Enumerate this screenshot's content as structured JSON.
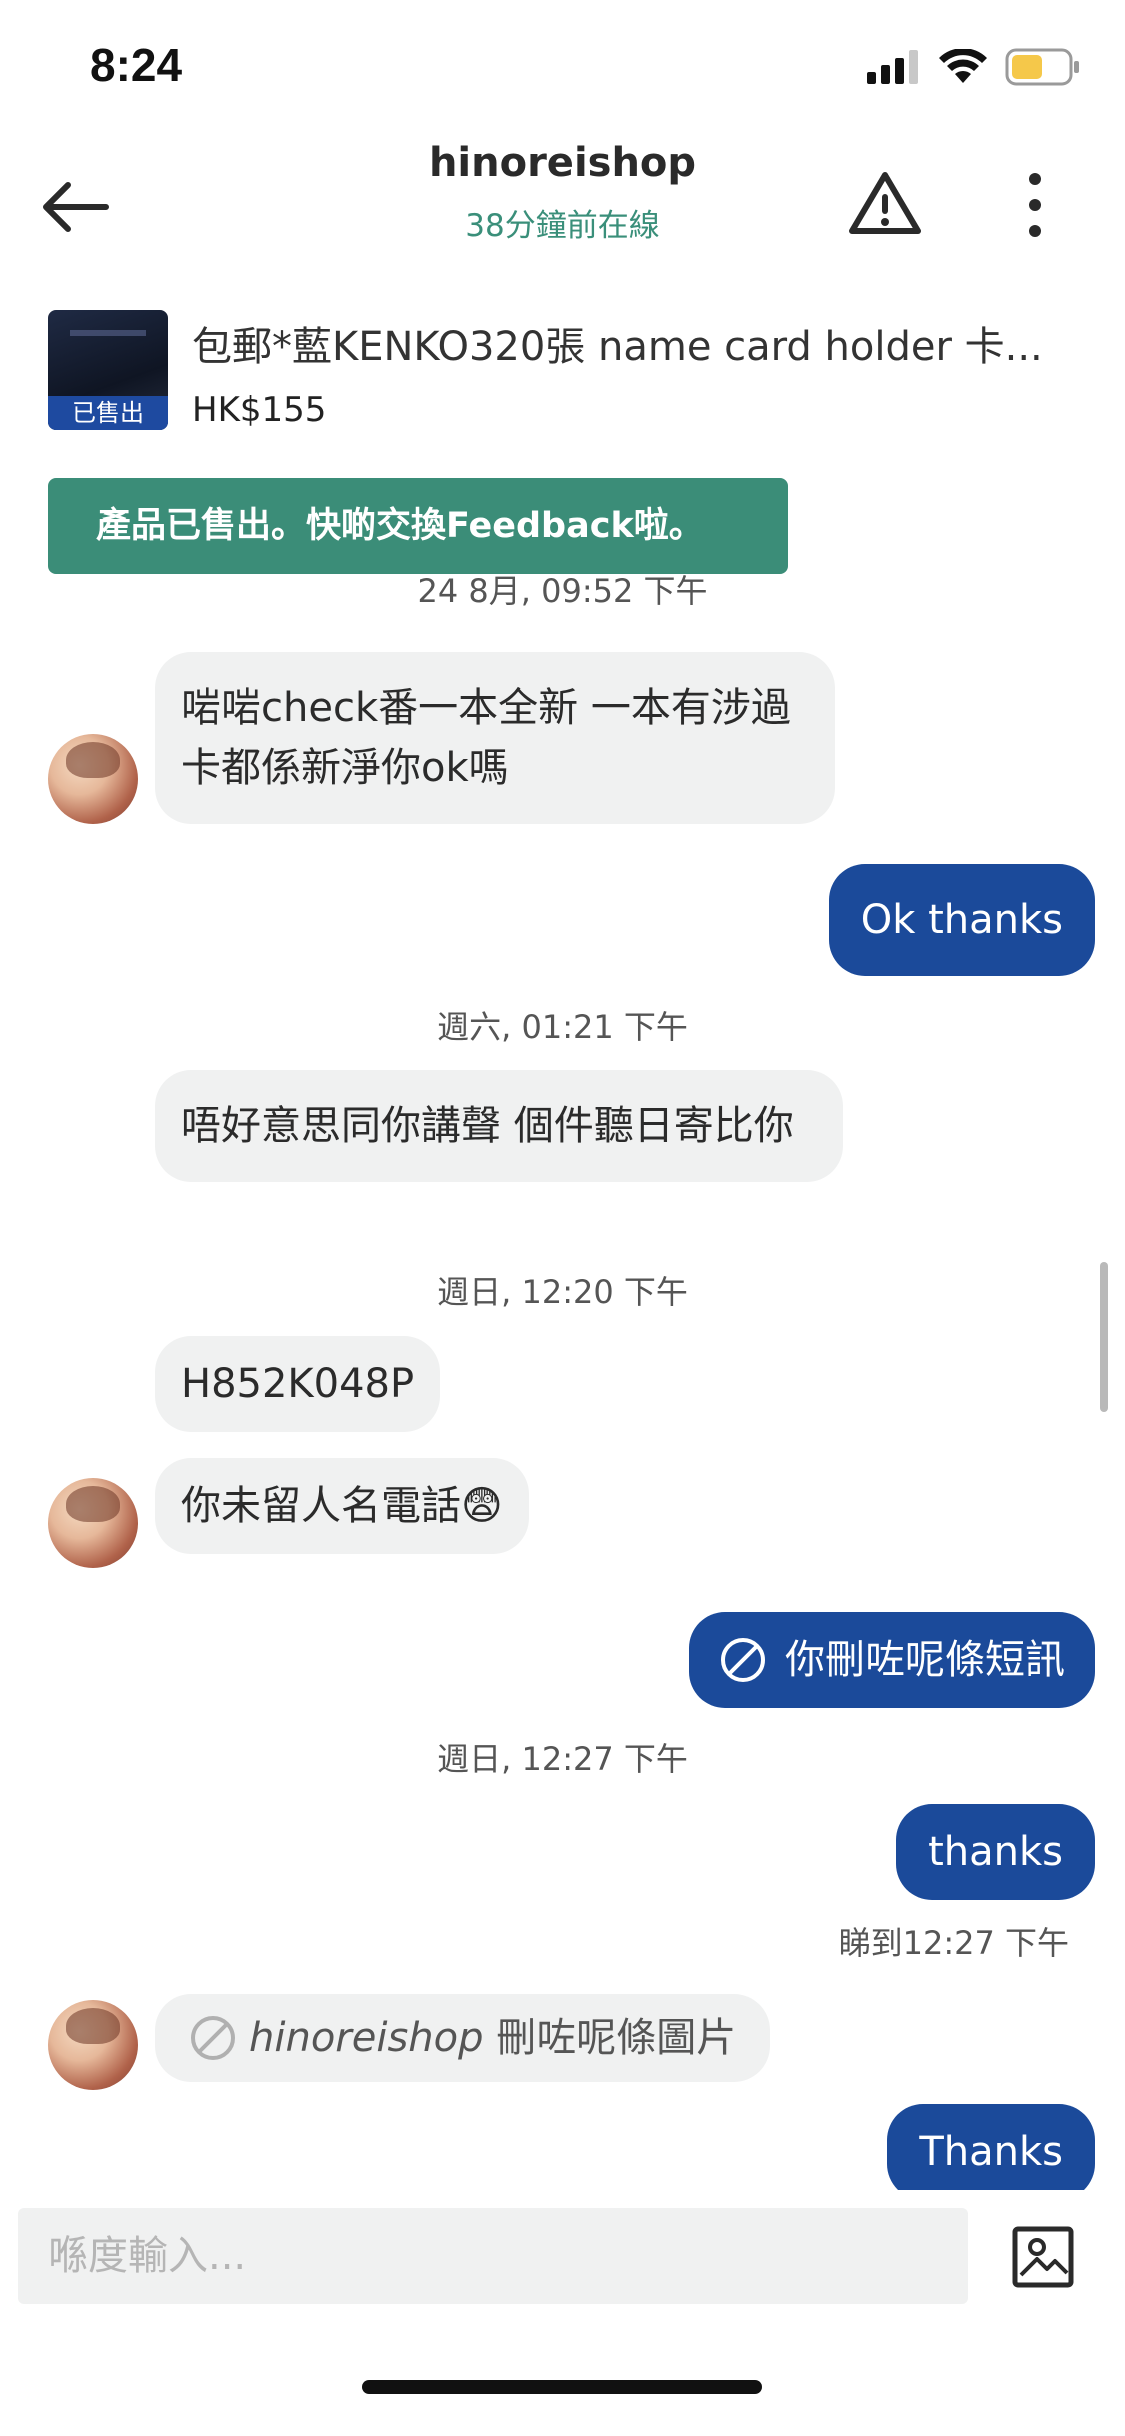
{
  "status_bar": {
    "time": "8:24",
    "icons": [
      "signal-icon",
      "wifi-icon",
      "battery-icon"
    ]
  },
  "header": {
    "title": "hinoreishop",
    "subtitle": "38分鐘前在線",
    "icons": [
      "back-arrow-icon",
      "warning-icon",
      "more-vertical-icon"
    ]
  },
  "product": {
    "title": "包郵*藍KENKO320張 name card holder 卡...",
    "price": "HK$155",
    "sold_tag": "已售出"
  },
  "banner": "產品已售出。快啲交換Feedback啦。",
  "messages": {
    "ts1": "24 8月, 09:52 下午",
    "m1": "啱啱check番一本全新 一本有涉過卡都係新淨你ok嗎",
    "m2": "Ok thanks",
    "ts2": "週六, 01:21 下午",
    "m3": "唔好意思同你講聲 個件聽日寄比你",
    "ts3": "週日, 12:20 下午",
    "m4": "H852K048P",
    "m5": "你未留人名電話😨",
    "m6": "你刪咗呢條短訊",
    "ts4": "週日, 12:27 下午",
    "m7": "thanks",
    "read": "睇到12:27 下午",
    "m8_name": "hinoreishop",
    "m8_text": " 刪咗呢條圖片",
    "m9": "Thanks"
  },
  "input": {
    "placeholder": "喺度輸入..."
  },
  "colors": {
    "accent_green": "#3b8d78",
    "outgoing_bubble": "#1b4a9a",
    "incoming_bubble": "#f0f1f1",
    "battery": "#f5c84a"
  }
}
